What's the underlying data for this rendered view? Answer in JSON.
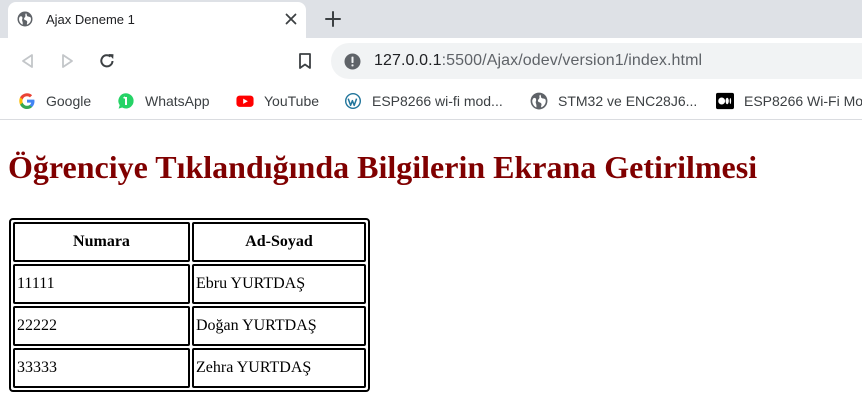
{
  "browser": {
    "tab": {
      "title": "Ajax Deneme 1"
    },
    "url": {
      "host": "127.0.0.1",
      "rest": ":5500/Ajax/odev/version1/index.html"
    }
  },
  "bookmarks": [
    {
      "label": "Google",
      "icon": "google-icon"
    },
    {
      "label": "WhatsApp",
      "icon": "whatsapp-icon"
    },
    {
      "label": "YouTube",
      "icon": "youtube-icon"
    },
    {
      "label": "ESP8266 wi-fi mod...",
      "icon": "wordpress-icon"
    },
    {
      "label": "STM32 ve ENC28J6...",
      "icon": "globe-icon"
    },
    {
      "label": "ESP8266 Wi-Fi Mo",
      "icon": "medium-icon"
    }
  ],
  "page": {
    "heading": "Öğrenciye Tıklandığında Bilgilerin Ekrana Getirilmesi",
    "table": {
      "headers": [
        "Numara",
        "Ad-Soyad"
      ],
      "rows": [
        [
          "11111",
          "Ebru YURTDAŞ"
        ],
        [
          "22222",
          "Doğan YURTDAŞ"
        ],
        [
          "33333",
          "Zehra YURTDAŞ"
        ]
      ]
    }
  },
  "colors": {
    "heading": "#800000",
    "tabstrip": "#dee1e6",
    "omnibox": "#f1f3f4"
  }
}
